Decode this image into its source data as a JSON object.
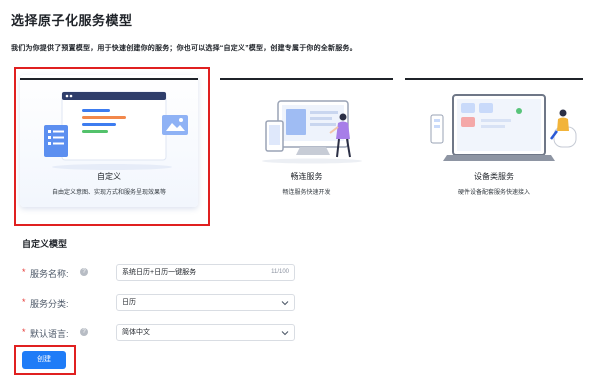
{
  "page": {
    "title": "选择原子化服务模型",
    "description": "我们为你提供了预置模型，用于快速创建你的服务；你也可以选择“自定义”模型，创建专属于你的全新服务。"
  },
  "models": [
    {
      "title": "自定义",
      "desc": "自由定义意图、实现方式和服务呈现效果等",
      "selected": true
    },
    {
      "title": "畅连服务",
      "desc": "畅连服务快速开发",
      "selected": false
    },
    {
      "title": "设备类服务",
      "desc": "硬件设备配套服务快速接入",
      "selected": false
    }
  ],
  "form": {
    "section_title": "自定义模型",
    "required_mark": "*",
    "help_icon": "?",
    "service_name": {
      "label": "服务名称:",
      "value": "系统日历+日历一键服务",
      "counter": "11/100"
    },
    "service_category": {
      "label": "服务分类:",
      "value": "日历"
    },
    "default_language": {
      "label": "默认语言:",
      "value": "简体中文"
    },
    "create_button": "创建"
  },
  "colors": {
    "primary": "#1f7cf7",
    "highlight": "#e02020",
    "required": "#e53935"
  }
}
